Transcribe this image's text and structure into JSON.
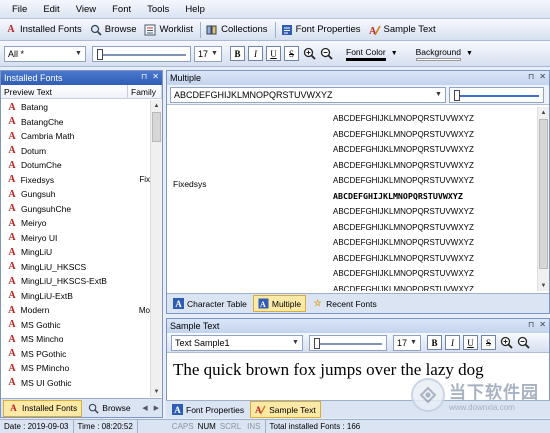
{
  "menu": [
    "File",
    "Edit",
    "View",
    "Font",
    "Tools",
    "Help"
  ],
  "toolbar": {
    "installed_fonts": "Installed Fonts",
    "browse": "Browse",
    "worklist": "Worklist",
    "collections": "Collections",
    "font_properties": "Font Properties",
    "sample_text": "Sample Text"
  },
  "format_bar": {
    "filter_value": "All *",
    "size_value": "17",
    "bold": "B",
    "italic": "I",
    "underline": "U",
    "strike": "S",
    "font_color_label": "Font Color",
    "background_label": "Background",
    "font_color": "#000000",
    "background_color": "#ffffff"
  },
  "left_panel": {
    "title": "Installed Fonts",
    "col_preview": "Preview Text",
    "col_family": "Family",
    "fonts": [
      {
        "name": "Batang",
        "family": ""
      },
      {
        "name": "BatangChe",
        "family": ""
      },
      {
        "name": "Cambria Math",
        "family": ""
      },
      {
        "name": "Dotum",
        "family": ""
      },
      {
        "name": "DotumChe",
        "family": ""
      },
      {
        "name": "Fixedsys",
        "family": "Fix"
      },
      {
        "name": "Gungsuh",
        "family": ""
      },
      {
        "name": "GungsuhChe",
        "family": ""
      },
      {
        "name": "Meiryo",
        "family": ""
      },
      {
        "name": "Meiryo UI",
        "family": ""
      },
      {
        "name": "MingLiU",
        "family": ""
      },
      {
        "name": "MingLiU_HKSCS",
        "family": ""
      },
      {
        "name": "MingLiU_HKSCS-ExtB",
        "family": ""
      },
      {
        "name": "MingLiU-ExtB",
        "family": ""
      },
      {
        "name": "Modern",
        "family": "Mo"
      },
      {
        "name": "MS Gothic",
        "family": ""
      },
      {
        "name": "MS Mincho",
        "family": ""
      },
      {
        "name": "MS PGothic",
        "family": ""
      },
      {
        "name": "MS PMincho",
        "family": ""
      },
      {
        "name": "MS UI Gothic",
        "family": ""
      }
    ],
    "tabs": [
      "Installed Fonts",
      "Browse"
    ]
  },
  "multiple_panel": {
    "title": "Multiple",
    "sample_value": "ABCDEFGHIJKLMNOPQRSTUVWXYZ",
    "font_label": "Fixedsys",
    "lines": [
      "ABCDEFGHIJKLMNOPQRSTUVWXYZ",
      "ABCDEFGHIJKLMNOPQRSTUVWXYZ",
      "ABCDEFGHIJKLMNOPQRSTUVWXYZ",
      "ABCDEFGHIJKLMNOPQRSTUVWXYZ",
      "ABCDEFGHIJKLMNOPQRSTUVWXYZ",
      "ABCDEFGHIJKLMNOPQRSTUVWXYZ",
      "ABCDEFGHIJKLMNOPQRSTUVWXYZ",
      "ABCDEFGHIJKLMNOPQRSTUVWXYZ",
      "ABCDEFGHIJKLMNOPQRSTUVWXYZ",
      "ABCDEFGHIJKLMNOPQRSTUVWXYZ",
      "ABCDEFGHIJKLMNOPQRSTUVWXYZ",
      "ABCDEFGHIJKLMNOPQRSTUVWXYZ"
    ],
    "tabs": [
      "Character Table",
      "Multiple",
      "Recent Fonts"
    ]
  },
  "sample_panel": {
    "title": "Sample Text",
    "sample_select": "Text Sample1",
    "size_value": "17",
    "text": "The quick brown fox jumps over the lazy dog",
    "tabs": [
      "Font Properties",
      "Sample Text"
    ]
  },
  "status": {
    "date": "Date : 2019-09-03",
    "time": "Time : 08:20:52",
    "caps": "CAPS",
    "num": "NUM",
    "scrl": "SCRL",
    "ins": "INS",
    "total": "Total installed Fonts : 166"
  },
  "watermark": {
    "line1": "当下软件园",
    "line2": "www.downxia.com"
  }
}
